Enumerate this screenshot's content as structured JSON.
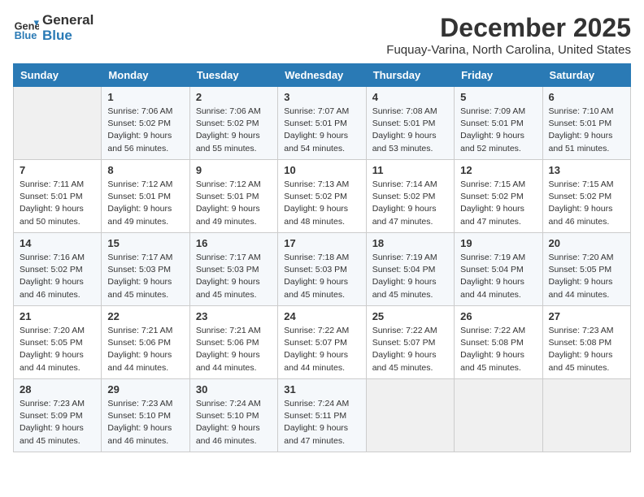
{
  "header": {
    "logo_line1": "General",
    "logo_line2": "Blue",
    "month": "December 2025",
    "location": "Fuquay-Varina, North Carolina, United States"
  },
  "weekdays": [
    "Sunday",
    "Monday",
    "Tuesday",
    "Wednesday",
    "Thursday",
    "Friday",
    "Saturday"
  ],
  "weeks": [
    [
      {
        "day": "",
        "sunrise": "",
        "sunset": "",
        "daylight": ""
      },
      {
        "day": "1",
        "sunrise": "Sunrise: 7:06 AM",
        "sunset": "Sunset: 5:02 PM",
        "daylight": "Daylight: 9 hours and 56 minutes."
      },
      {
        "day": "2",
        "sunrise": "Sunrise: 7:06 AM",
        "sunset": "Sunset: 5:02 PM",
        "daylight": "Daylight: 9 hours and 55 minutes."
      },
      {
        "day": "3",
        "sunrise": "Sunrise: 7:07 AM",
        "sunset": "Sunset: 5:01 PM",
        "daylight": "Daylight: 9 hours and 54 minutes."
      },
      {
        "day": "4",
        "sunrise": "Sunrise: 7:08 AM",
        "sunset": "Sunset: 5:01 PM",
        "daylight": "Daylight: 9 hours and 53 minutes."
      },
      {
        "day": "5",
        "sunrise": "Sunrise: 7:09 AM",
        "sunset": "Sunset: 5:01 PM",
        "daylight": "Daylight: 9 hours and 52 minutes."
      },
      {
        "day": "6",
        "sunrise": "Sunrise: 7:10 AM",
        "sunset": "Sunset: 5:01 PM",
        "daylight": "Daylight: 9 hours and 51 minutes."
      }
    ],
    [
      {
        "day": "7",
        "sunrise": "Sunrise: 7:11 AM",
        "sunset": "Sunset: 5:01 PM",
        "daylight": "Daylight: 9 hours and 50 minutes."
      },
      {
        "day": "8",
        "sunrise": "Sunrise: 7:12 AM",
        "sunset": "Sunset: 5:01 PM",
        "daylight": "Daylight: 9 hours and 49 minutes."
      },
      {
        "day": "9",
        "sunrise": "Sunrise: 7:12 AM",
        "sunset": "Sunset: 5:01 PM",
        "daylight": "Daylight: 9 hours and 49 minutes."
      },
      {
        "day": "10",
        "sunrise": "Sunrise: 7:13 AM",
        "sunset": "Sunset: 5:02 PM",
        "daylight": "Daylight: 9 hours and 48 minutes."
      },
      {
        "day": "11",
        "sunrise": "Sunrise: 7:14 AM",
        "sunset": "Sunset: 5:02 PM",
        "daylight": "Daylight: 9 hours and 47 minutes."
      },
      {
        "day": "12",
        "sunrise": "Sunrise: 7:15 AM",
        "sunset": "Sunset: 5:02 PM",
        "daylight": "Daylight: 9 hours and 47 minutes."
      },
      {
        "day": "13",
        "sunrise": "Sunrise: 7:15 AM",
        "sunset": "Sunset: 5:02 PM",
        "daylight": "Daylight: 9 hours and 46 minutes."
      }
    ],
    [
      {
        "day": "14",
        "sunrise": "Sunrise: 7:16 AM",
        "sunset": "Sunset: 5:02 PM",
        "daylight": "Daylight: 9 hours and 46 minutes."
      },
      {
        "day": "15",
        "sunrise": "Sunrise: 7:17 AM",
        "sunset": "Sunset: 5:03 PM",
        "daylight": "Daylight: 9 hours and 45 minutes."
      },
      {
        "day": "16",
        "sunrise": "Sunrise: 7:17 AM",
        "sunset": "Sunset: 5:03 PM",
        "daylight": "Daylight: 9 hours and 45 minutes."
      },
      {
        "day": "17",
        "sunrise": "Sunrise: 7:18 AM",
        "sunset": "Sunset: 5:03 PM",
        "daylight": "Daylight: 9 hours and 45 minutes."
      },
      {
        "day": "18",
        "sunrise": "Sunrise: 7:19 AM",
        "sunset": "Sunset: 5:04 PM",
        "daylight": "Daylight: 9 hours and 45 minutes."
      },
      {
        "day": "19",
        "sunrise": "Sunrise: 7:19 AM",
        "sunset": "Sunset: 5:04 PM",
        "daylight": "Daylight: 9 hours and 44 minutes."
      },
      {
        "day": "20",
        "sunrise": "Sunrise: 7:20 AM",
        "sunset": "Sunset: 5:05 PM",
        "daylight": "Daylight: 9 hours and 44 minutes."
      }
    ],
    [
      {
        "day": "21",
        "sunrise": "Sunrise: 7:20 AM",
        "sunset": "Sunset: 5:05 PM",
        "daylight": "Daylight: 9 hours and 44 minutes."
      },
      {
        "day": "22",
        "sunrise": "Sunrise: 7:21 AM",
        "sunset": "Sunset: 5:06 PM",
        "daylight": "Daylight: 9 hours and 44 minutes."
      },
      {
        "day": "23",
        "sunrise": "Sunrise: 7:21 AM",
        "sunset": "Sunset: 5:06 PM",
        "daylight": "Daylight: 9 hours and 44 minutes."
      },
      {
        "day": "24",
        "sunrise": "Sunrise: 7:22 AM",
        "sunset": "Sunset: 5:07 PM",
        "daylight": "Daylight: 9 hours and 44 minutes."
      },
      {
        "day": "25",
        "sunrise": "Sunrise: 7:22 AM",
        "sunset": "Sunset: 5:07 PM",
        "daylight": "Daylight: 9 hours and 45 minutes."
      },
      {
        "day": "26",
        "sunrise": "Sunrise: 7:22 AM",
        "sunset": "Sunset: 5:08 PM",
        "daylight": "Daylight: 9 hours and 45 minutes."
      },
      {
        "day": "27",
        "sunrise": "Sunrise: 7:23 AM",
        "sunset": "Sunset: 5:08 PM",
        "daylight": "Daylight: 9 hours and 45 minutes."
      }
    ],
    [
      {
        "day": "28",
        "sunrise": "Sunrise: 7:23 AM",
        "sunset": "Sunset: 5:09 PM",
        "daylight": "Daylight: 9 hours and 45 minutes."
      },
      {
        "day": "29",
        "sunrise": "Sunrise: 7:23 AM",
        "sunset": "Sunset: 5:10 PM",
        "daylight": "Daylight: 9 hours and 46 minutes."
      },
      {
        "day": "30",
        "sunrise": "Sunrise: 7:24 AM",
        "sunset": "Sunset: 5:10 PM",
        "daylight": "Daylight: 9 hours and 46 minutes."
      },
      {
        "day": "31",
        "sunrise": "Sunrise: 7:24 AM",
        "sunset": "Sunset: 5:11 PM",
        "daylight": "Daylight: 9 hours and 47 minutes."
      },
      {
        "day": "",
        "sunrise": "",
        "sunset": "",
        "daylight": ""
      },
      {
        "day": "",
        "sunrise": "",
        "sunset": "",
        "daylight": ""
      },
      {
        "day": "",
        "sunrise": "",
        "sunset": "",
        "daylight": ""
      }
    ]
  ]
}
